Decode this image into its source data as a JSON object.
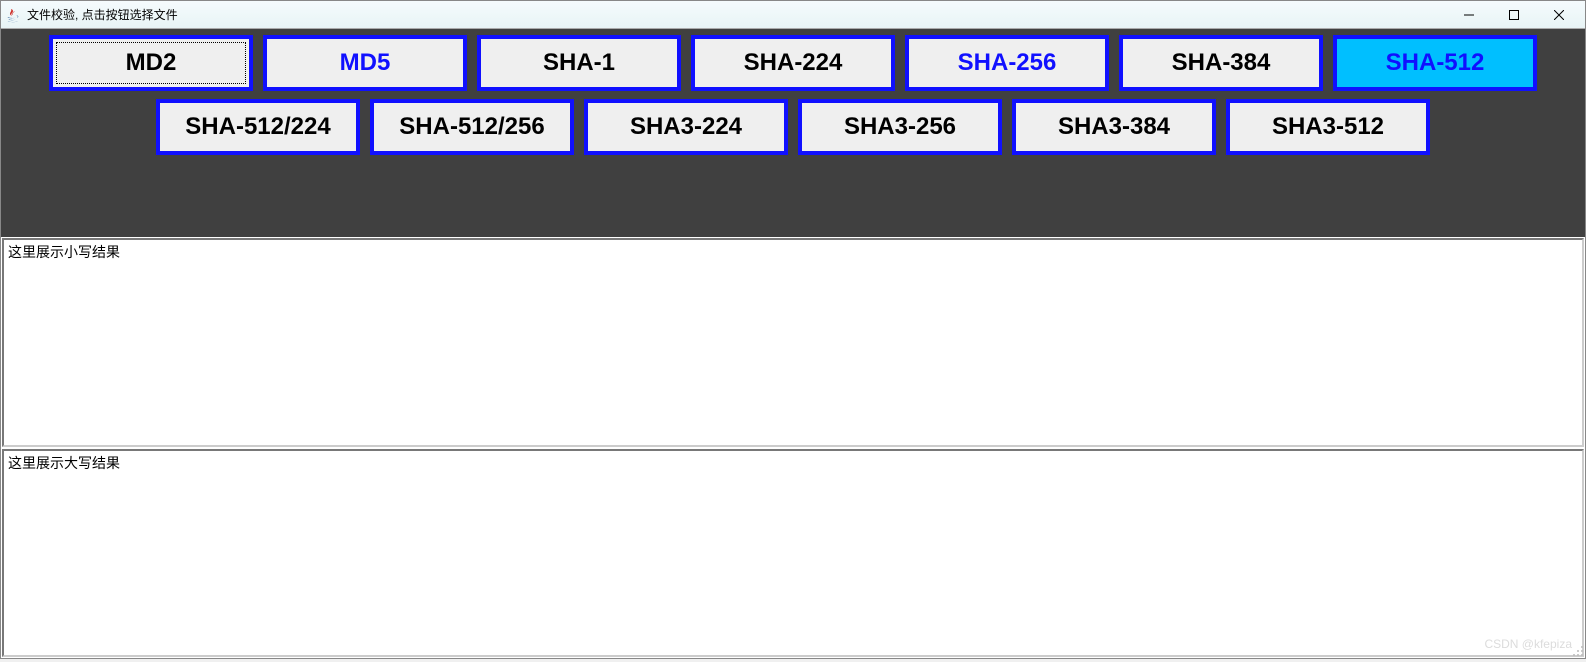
{
  "window": {
    "title": "文件校验, 点击按钮选择文件"
  },
  "buttons": {
    "row1": [
      {
        "label": "MD2",
        "focused": true,
        "blueText": false,
        "selected": false
      },
      {
        "label": "MD5",
        "focused": false,
        "blueText": true,
        "selected": false
      },
      {
        "label": "SHA-1",
        "focused": false,
        "blueText": false,
        "selected": false
      },
      {
        "label": "SHA-224",
        "focused": false,
        "blueText": false,
        "selected": false
      },
      {
        "label": "SHA-256",
        "focused": false,
        "blueText": true,
        "selected": false
      },
      {
        "label": "SHA-384",
        "focused": false,
        "blueText": false,
        "selected": false
      },
      {
        "label": "SHA-512",
        "focused": false,
        "blueText": true,
        "selected": true
      }
    ],
    "row2": [
      {
        "label": "SHA-512/224"
      },
      {
        "label": "SHA-512/256"
      },
      {
        "label": "SHA3-224"
      },
      {
        "label": "SHA3-256"
      },
      {
        "label": "SHA3-384"
      },
      {
        "label": "SHA3-512"
      }
    ]
  },
  "results": {
    "lowercase_placeholder": "这里展示小写结果",
    "uppercase_placeholder": "这里展示大写结果"
  },
  "watermark": "CSDN @kfepiza"
}
